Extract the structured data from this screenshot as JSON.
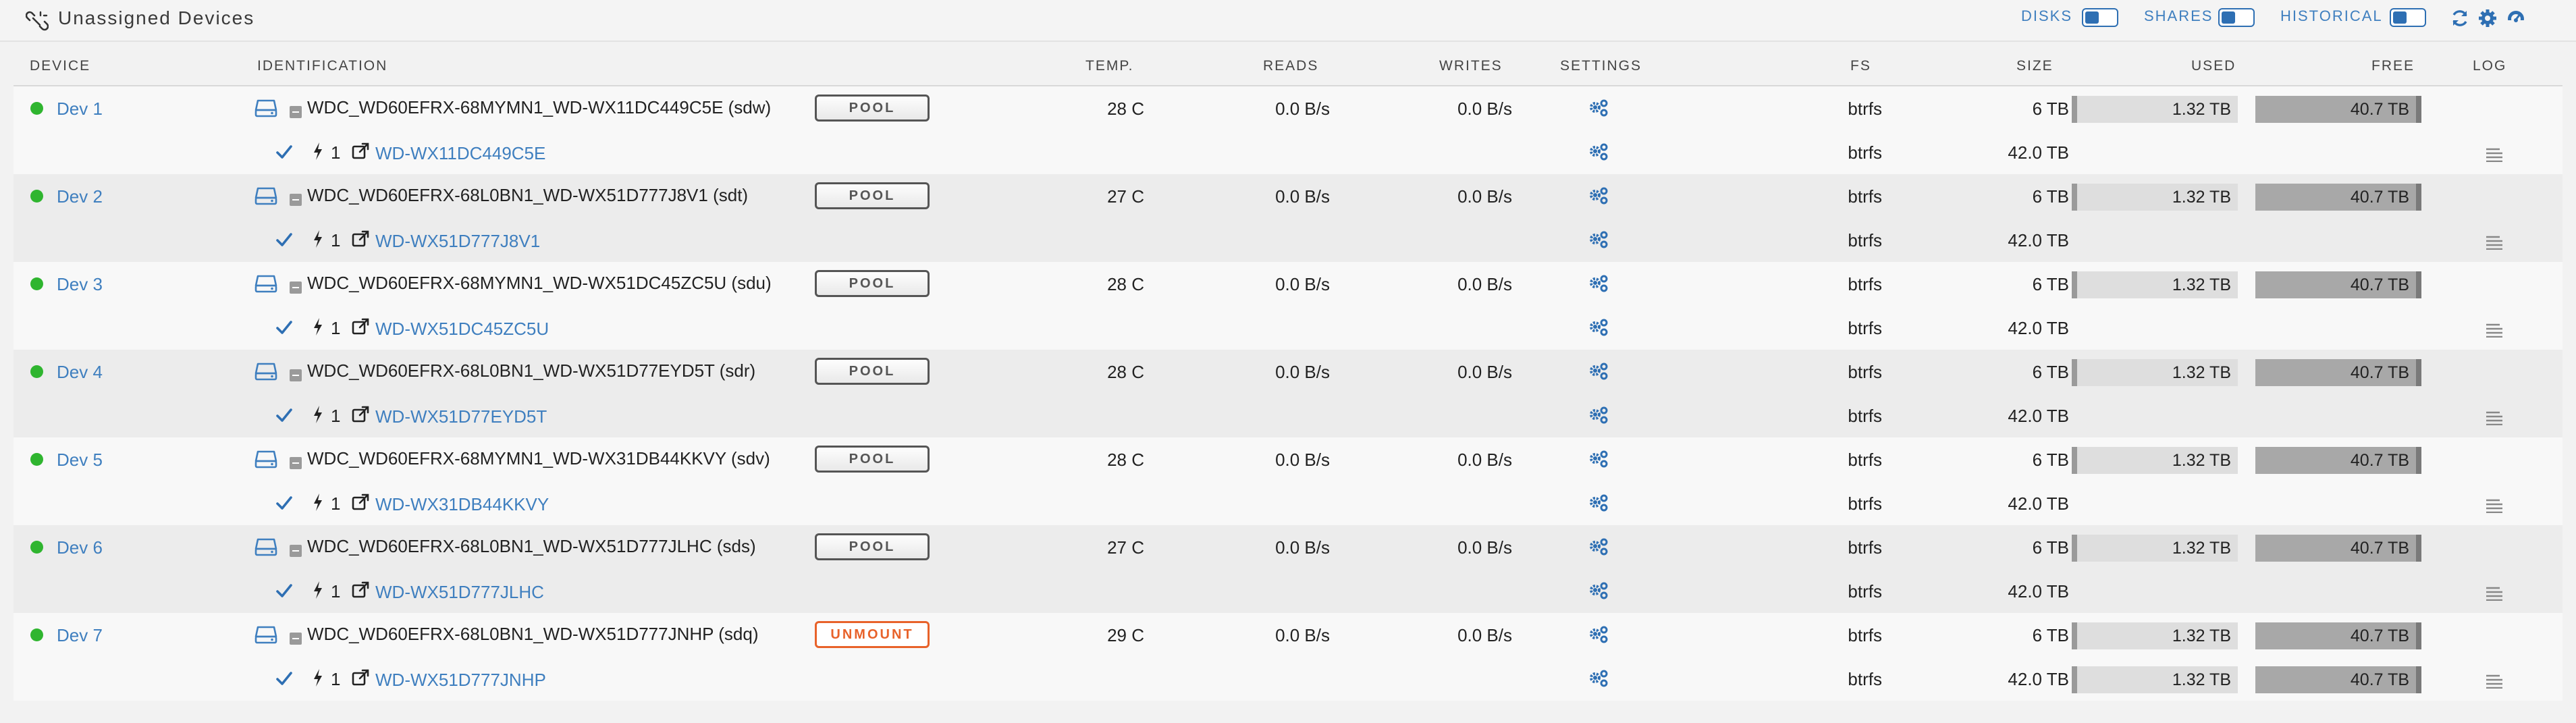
{
  "header": {
    "title": "Unassigned Devices",
    "toggles": [
      {
        "label": "DISKS"
      },
      {
        "label": "SHARES"
      },
      {
        "label": "HISTORICAL"
      }
    ],
    "icons": [
      "refresh-icon",
      "gear-icon",
      "dashboard-icon"
    ]
  },
  "columns": {
    "device": "DEVICE",
    "identification": "IDENTIFICATION",
    "temp": "TEMP.",
    "reads": "READS",
    "writes": "WRITES",
    "settings": "SETTINGS",
    "fs": "FS",
    "size": "SIZE",
    "used": "USED",
    "free": "FREE",
    "log": "LOG"
  },
  "colors": {
    "accent": "#3f7fbf",
    "status_online": "#2fb52f",
    "unmount": "#e8622a"
  },
  "devices": [
    {
      "name": "Dev 1",
      "ident": "WDC_WD60EFRX-68MYMN1_WD-WX11DC449C5E (sdw)",
      "button": "POOL",
      "temp": "28 C",
      "reads": "0.0 B/s",
      "writes": "0.0 B/s",
      "fs": "btrfs",
      "size": "6 TB",
      "used": "1.32 TB",
      "free": "40.7 TB",
      "part": {
        "num": "1",
        "serial": "WD-WX11DC449C5E",
        "fs": "btrfs",
        "size": "42.0 TB"
      }
    },
    {
      "name": "Dev 2",
      "ident": "WDC_WD60EFRX-68L0BN1_WD-WX51D777J8V1 (sdt)",
      "button": "POOL",
      "temp": "27 C",
      "reads": "0.0 B/s",
      "writes": "0.0 B/s",
      "fs": "btrfs",
      "size": "6 TB",
      "used": "1.32 TB",
      "free": "40.7 TB",
      "part": {
        "num": "1",
        "serial": "WD-WX51D777J8V1",
        "fs": "btrfs",
        "size": "42.0 TB"
      }
    },
    {
      "name": "Dev 3",
      "ident": "WDC_WD60EFRX-68MYMN1_WD-WX51DC45ZC5U (sdu)",
      "button": "POOL",
      "temp": "28 C",
      "reads": "0.0 B/s",
      "writes": "0.0 B/s",
      "fs": "btrfs",
      "size": "6 TB",
      "used": "1.32 TB",
      "free": "40.7 TB",
      "part": {
        "num": "1",
        "serial": "WD-WX51DC45ZC5U",
        "fs": "btrfs",
        "size": "42.0 TB"
      }
    },
    {
      "name": "Dev 4",
      "ident": "WDC_WD60EFRX-68L0BN1_WD-WX51D77EYD5T (sdr)",
      "button": "POOL",
      "temp": "28 C",
      "reads": "0.0 B/s",
      "writes": "0.0 B/s",
      "fs": "btrfs",
      "size": "6 TB",
      "used": "1.32 TB",
      "free": "40.7 TB",
      "part": {
        "num": "1",
        "serial": "WD-WX51D77EYD5T",
        "fs": "btrfs",
        "size": "42.0 TB"
      }
    },
    {
      "name": "Dev 5",
      "ident": "WDC_WD60EFRX-68MYMN1_WD-WX31DB44KKVY (sdv)",
      "button": "POOL",
      "temp": "28 C",
      "reads": "0.0 B/s",
      "writes": "0.0 B/s",
      "fs": "btrfs",
      "size": "6 TB",
      "used": "1.32 TB",
      "free": "40.7 TB",
      "part": {
        "num": "1",
        "serial": "WD-WX31DB44KKVY",
        "fs": "btrfs",
        "size": "42.0 TB"
      }
    },
    {
      "name": "Dev 6",
      "ident": "WDC_WD60EFRX-68L0BN1_WD-WX51D777JLHC (sds)",
      "button": "POOL",
      "temp": "27 C",
      "reads": "0.0 B/s",
      "writes": "0.0 B/s",
      "fs": "btrfs",
      "size": "6 TB",
      "used": "1.32 TB",
      "free": "40.7 TB",
      "part": {
        "num": "1",
        "serial": "WD-WX51D777JLHC",
        "fs": "btrfs",
        "size": "42.0 TB"
      }
    },
    {
      "name": "Dev 7",
      "ident": "WDC_WD60EFRX-68L0BN1_WD-WX51D777JNHP (sdq)",
      "button": "UNMOUNT",
      "temp": "29 C",
      "reads": "0.0 B/s",
      "writes": "0.0 B/s",
      "fs": "btrfs",
      "size": "6 TB",
      "used": "1.32 TB",
      "free": "40.7 TB",
      "part": {
        "num": "1",
        "serial": "WD-WX51D777JNHP",
        "fs": "btrfs",
        "size": "42.0 TB",
        "used": "1.32 TB",
        "free": "40.7 TB"
      }
    }
  ]
}
